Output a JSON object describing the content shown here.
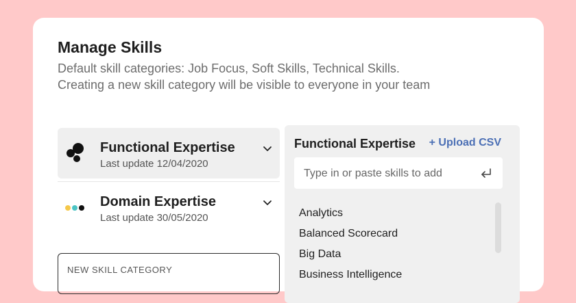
{
  "header": {
    "title": "Manage Skills",
    "description_line1": "Default skill categories: Job Focus, Soft Skills, Technical Skills.",
    "description_line2": "Creating a new skill category will be visible to everyone in your team"
  },
  "categories": [
    {
      "name": "Functional Expertise",
      "updated": "Last update 12/04/2020",
      "icon": "bubbles-icon",
      "active": true
    },
    {
      "name": "Domain Expertise",
      "updated": "Last update 30/05/2020",
      "icon": "dots-icon",
      "active": false
    }
  ],
  "new_category": {
    "label": "NEW SKILL CATEGORY"
  },
  "panel": {
    "title": "Functional Expertise",
    "upload_label": "+ Upload CSV",
    "input_placeholder": "Type in or paste skills to add",
    "skills": [
      "Analytics",
      "Balanced Scorecard",
      "Big Data",
      "Business Intelligence"
    ]
  },
  "colors": {
    "background": "#ffc9c9",
    "accent": "#4b6fb5",
    "dot_yellow": "#f5c84a",
    "dot_teal": "#4cc4c4",
    "dot_black": "#111111"
  }
}
